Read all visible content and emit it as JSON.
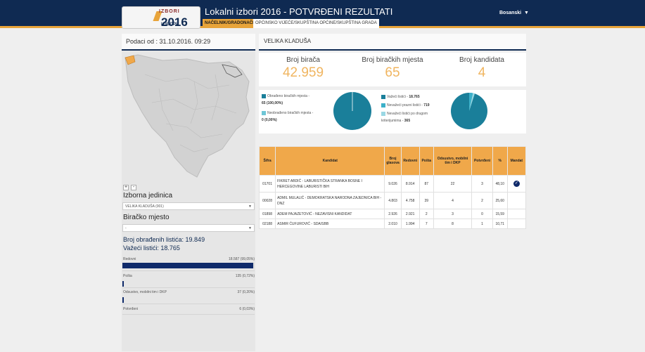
{
  "header": {
    "logo": {
      "top": "IZBORI",
      "year": "2016",
      "bottom": "ИЗБОРИ"
    },
    "title": "Lokalni izbori 2016 - POTVRĐENI REZULTATI",
    "tabs": [
      {
        "label": "NAČELNIK/GRADONAČELNIK",
        "active": true
      },
      {
        "label": "OPĆINSKO VIJEĆE/SKUPŠTINA OPĆINE/SKUPŠTINA GRADA",
        "active": false
      }
    ],
    "language": "Bosanski",
    "language_arrow": "▼"
  },
  "sidebar": {
    "date": "Podaci od : 31.10.2016. 09:29",
    "zoom_in": "+",
    "zoom_out": "-",
    "unit_label": "Izborna jedinica",
    "unit_value": "VELIKA KLADUŠA (001)",
    "station_label": "Biračko mjesto",
    "station_value": "-",
    "processed": "Broj obrađenih listića: 19.849",
    "valid": "Važeći listići: 18.765",
    "rows": [
      {
        "label": "Redovni",
        "value": "18.587 (99,05%)",
        "pct": 99.05
      },
      {
        "label": "Pošta",
        "value": "135 (0,72%)",
        "pct": 0.72
      },
      {
        "label": "Odsustvo, mobilni tim i DKP",
        "value": "37 (0,20%)",
        "pct": 0.2
      },
      {
        "label": "Potvrđeni",
        "value": "6 (0,03%)",
        "pct": 0.03
      }
    ]
  },
  "main": {
    "municipality": "VELIKA KLADUŠA",
    "counts": [
      {
        "label": "Broj birača",
        "value": "42.959"
      },
      {
        "label": "Broj biračkih mjesta",
        "value": "65"
      },
      {
        "label": "Broj kandidata",
        "value": "4"
      }
    ],
    "legend_left": [
      {
        "text": "Obrađeno biračkih mjesta -",
        "value": "65 (100,00%)",
        "color": "#1a7f9a"
      },
      {
        "text": "Neobrađeno biračkih mjesta -",
        "value": "0 (0,00%)",
        "color": "#6fc6d6"
      }
    ],
    "legend_right": [
      {
        "text": "Važeći listići - ",
        "value": "18.765",
        "color": "#1a7f9a"
      },
      {
        "text": "Nevažeći prazni listići - ",
        "value": "719",
        "color": "#3bb0c9"
      },
      {
        "text": "Nevažeći listići po drugom kriterijumima - ",
        "value": "365",
        "color": "#9ad8e4"
      }
    ],
    "table": {
      "headers": [
        "Šifra",
        "Kandidat",
        "Broj glasova",
        "Redovni",
        "Pošta",
        "Odsustvo, mobilni tim i DKP",
        "Potvrđeni",
        "%",
        "Mandat"
      ],
      "rows": [
        [
          "01701",
          "FIKRET ABDIĆ - LABURISTIČKA STRANKA BOSNE I HERCEGOVINE LABURISTI BIH",
          "9.026",
          "8.914",
          "87",
          "22",
          "3",
          "48,10",
          "check"
        ],
        [
          "00028",
          "ADMIL MULALIĆ - DEMOKRATSKA NARODNA ZAJEDNICA BIH - DNZ",
          "4.803",
          "4.758",
          "39",
          "4",
          "2",
          "25,60",
          ""
        ],
        [
          "01898",
          "ADEM PAJAZETOVIĆ - NEZAVISNI KANDIDAT",
          "2.926",
          "2.921",
          "2",
          "3",
          "0",
          "15,59",
          ""
        ],
        [
          "02188",
          "ASMIR ĆUFUROVIĆ - SDA/SBB",
          "2.010",
          "1.994",
          "7",
          "8",
          "1",
          "10,71",
          ""
        ]
      ]
    }
  },
  "colors": {
    "navy": "#0f2a52",
    "orange": "#e8a43a",
    "teal": "#1a7f9a",
    "light_teal": "#9ad8e4"
  },
  "icons": {
    "mandate": "check-circle-icon",
    "dropdown": "caret-down-icon"
  }
}
